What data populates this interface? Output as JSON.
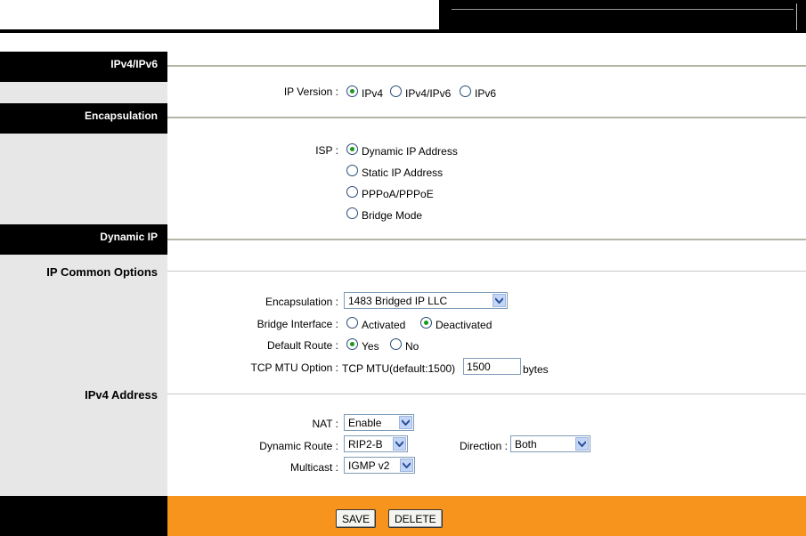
{
  "sections": {
    "ipv4ipv6": "IPv4/IPv6",
    "encapsulation": "Encapsulation",
    "dynamic_ip": "Dynamic IP",
    "ip_common_options": "IP Common Options",
    "ipv4_address": "IPv4 Address"
  },
  "ip_version": {
    "label": "IP Version :",
    "options": [
      "IPv4",
      "IPv4/IPv6",
      "IPv6"
    ],
    "selected": "IPv4"
  },
  "isp": {
    "label": "ISP :",
    "options": [
      "Dynamic IP Address",
      "Static IP Address",
      "PPPoA/PPPoE",
      "Bridge Mode"
    ],
    "selected": "Dynamic IP Address"
  },
  "common": {
    "encapsulation_label": "Encapsulation :",
    "encapsulation_value": "1483 Bridged IP LLC",
    "bridge_interface_label": "Bridge Interface :",
    "bridge_options": [
      "Activated",
      "Deactivated"
    ],
    "bridge_selected": "Deactivated",
    "default_route_label": "Default Route :",
    "default_route_options": [
      "Yes",
      "No"
    ],
    "default_route_selected": "Yes",
    "tcp_mtu_label": "TCP MTU Option :",
    "tcp_mtu_text": "TCP MTU(default:1500)",
    "tcp_mtu_value": "1500",
    "tcp_mtu_unit": "bytes"
  },
  "ipv4": {
    "nat_label": "NAT :",
    "nat_value": "Enable",
    "dynamic_route_label": "Dynamic Route :",
    "dynamic_route_value": "RIP2-B",
    "direction_label": "Direction :",
    "direction_value": "Both",
    "multicast_label": "Multicast :",
    "multicast_value": "IGMP v2"
  },
  "buttons": {
    "save": "SAVE",
    "delete": "DELETE"
  },
  "colors": {
    "footer_accent": "#f7941d",
    "section_header": "#000000",
    "sidebar": "#e7e7e7"
  }
}
